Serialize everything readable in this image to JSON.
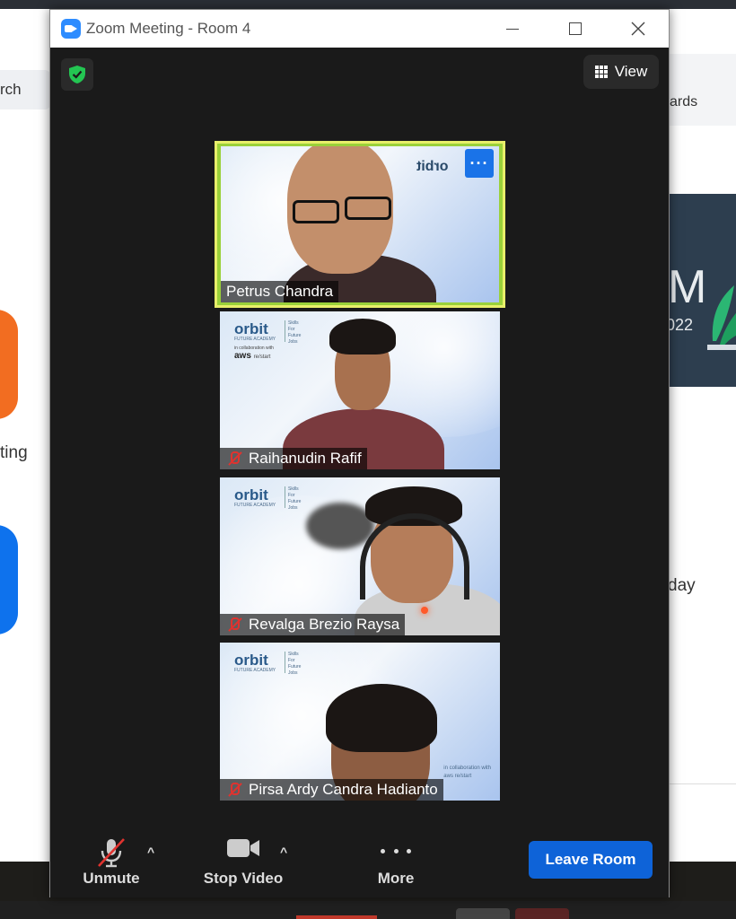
{
  "window": {
    "title": "Zoom Meeting - Room 4"
  },
  "background_app": {
    "search_fragment": "rch",
    "meeting_fragment": "ting",
    "cards_fragment": "ards",
    "banner_letter": "M",
    "banner_year_fragment": "022",
    "today_fragment": "day"
  },
  "header": {
    "view_label": "View"
  },
  "participants": [
    {
      "name": "Petrus Chandra",
      "muted": false,
      "active_speaker": true
    },
    {
      "name": "Raihanudin Rafif",
      "muted": true,
      "active_speaker": false
    },
    {
      "name": "Revalga Brezio Raysa",
      "muted": true,
      "active_speaker": false
    },
    {
      "name": "Pirsa Ardy Candra Hadianto",
      "muted": true,
      "active_speaker": false
    }
  ],
  "backgrounds": {
    "brand": "orbit",
    "brand_sub": "FUTURE ACADEMY",
    "tagline": "Skills For Future Jobs",
    "aws_prefix": "in collaboration with",
    "aws_text": "aws",
    "aws_suffix": "re/start",
    "collab_text": "in collaboration with",
    "collab_brand": "aws re/start"
  },
  "toolbar": {
    "unmute_label": "Unmute",
    "stop_video_label": "Stop Video",
    "more_label": "More",
    "leave_label": "Leave Room"
  },
  "colors": {
    "active_border": "#e8ef6a",
    "leave_button": "#0e63d8",
    "muted_red": "#e0332f",
    "shield_green": "#23c552"
  }
}
